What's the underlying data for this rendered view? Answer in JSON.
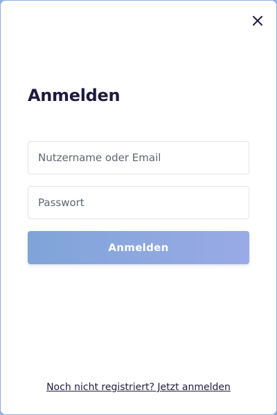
{
  "modal": {
    "title": "Anmelden",
    "close_icon": "close-icon"
  },
  "form": {
    "username_placeholder": "Nutzername oder Email",
    "username_value": "",
    "password_placeholder": "Passwort",
    "password_value": "",
    "submit_label": "Anmelden"
  },
  "footer": {
    "register_link": "Noch nicht registriert? Jetzt anmelden"
  },
  "colors": {
    "title_text": "#1f1b3f",
    "button_gradient_start": "#7fa4d9",
    "button_gradient_end": "#9aaae6",
    "border_accent": "#8fb0e3"
  }
}
